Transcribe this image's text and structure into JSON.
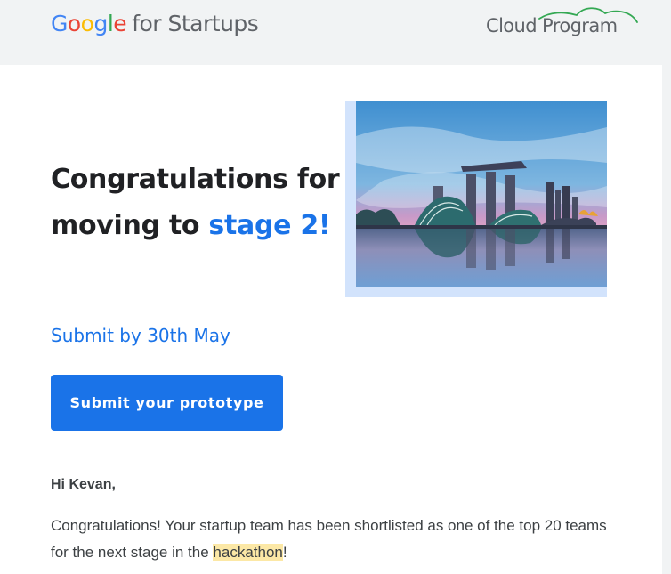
{
  "header": {
    "google_logo": {
      "letters": [
        {
          "ch": "G",
          "color": "#4285f4"
        },
        {
          "ch": "o",
          "color": "#ea4335"
        },
        {
          "ch": "o",
          "color": "#fbbc05"
        },
        {
          "ch": "g",
          "color": "#4285f4"
        },
        {
          "ch": "l",
          "color": "#34a853"
        },
        {
          "ch": "e",
          "color": "#ea4335"
        }
      ],
      "suffix": "for Startups"
    },
    "program_label": "Cloud Program",
    "program_icon": "cloud-outline-icon"
  },
  "headline": {
    "line1": "Congratulations for",
    "line2_prefix": "moving to",
    "line2_accent": "stage 2!"
  },
  "hero_image": {
    "icon": "city-skyline-image"
  },
  "deadline": "Submit by 30th May",
  "cta": {
    "label": "Submit your prototype"
  },
  "greeting": "Hi Kevan,",
  "body": {
    "before": "Congratulations! Your startup team has been shortlisted as one of the top 20 teams for the next stage in the ",
    "highlight": "hackathon",
    "after": "!"
  },
  "colors": {
    "accent": "#1a73e8",
    "header_bg": "#f1f3f4",
    "highlight": "#fce8a6",
    "text": "#3c4043"
  }
}
